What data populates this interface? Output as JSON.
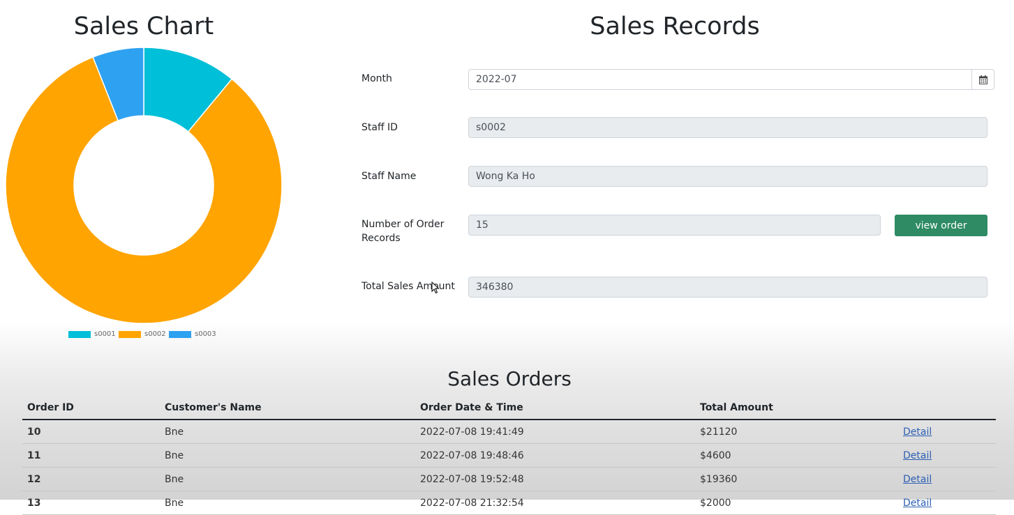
{
  "chart": {
    "title": "Sales Chart",
    "legend_placement": "bottom"
  },
  "chart_data": {
    "type": "pie",
    "donut": true,
    "categories": [
      "s0001",
      "s0002",
      "s0003"
    ],
    "values": [
      11,
      83,
      6
    ],
    "colors": [
      "#00bfd8",
      "#ffa400",
      "#2ea1f0"
    ]
  },
  "records": {
    "title": "Sales Records",
    "month_label": "Month",
    "month_value": "2022-07",
    "staff_id_label": "Staff ID",
    "staff_id_value": "s0002",
    "staff_name_label": "Staff Name",
    "staff_name_value": "Wong Ka Ho",
    "num_orders_label_1": "Number of Order",
    "num_orders_label_2": "Records",
    "num_orders_value": "15",
    "view_order_label": "view order",
    "total_sales_label": "Total Sales Amount",
    "total_sales_value": "346380"
  },
  "orders": {
    "title": "Sales Orders",
    "headers": [
      "Order ID",
      "Customer's Name",
      "Order Date & Time",
      "Total Amount",
      ""
    ],
    "rows": [
      {
        "id": "10",
        "customer": "Bne",
        "datetime": "2022-07-08 19:41:49",
        "amount": "$21120",
        "link": "Detail"
      },
      {
        "id": "11",
        "customer": "Bne",
        "datetime": "2022-07-08 19:48:46",
        "amount": "$4600",
        "link": "Detail"
      },
      {
        "id": "12",
        "customer": "Bne",
        "datetime": "2022-07-08 19:52:48",
        "amount": "$19360",
        "link": "Detail"
      },
      {
        "id": "13",
        "customer": "Bne",
        "datetime": "2022-07-08 21:32:54",
        "amount": "$2000",
        "link": "Detail"
      }
    ]
  },
  "icons": {
    "calendar": "calendar-icon"
  }
}
